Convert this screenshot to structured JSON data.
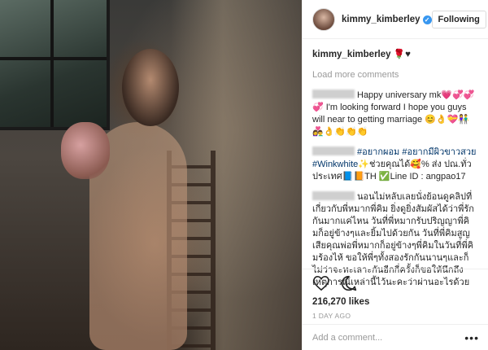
{
  "post": {
    "username": "kimmy_kimberley",
    "follow_label": "Following",
    "caption_emoji": "🌹♥",
    "load_more": "Load more comments",
    "comments": [
      {
        "text": "Happy universary mk💗💞💞💞 I'm looking forward I hope you guys will near to getting marriage 😊👌💝👫👩‍❤️‍👨👌👏👏👏"
      },
      {
        "tags": "#อยากผอม #อยากมีผิวขาวสวย #Winkwhite",
        "text": "✨ช่วยคุณได้🥰% ส่ง ปณ.ทั่วประเทศ📘📙TH ✅Line ID : angpao17"
      },
      {
        "text": "นอนไม่หลับเลยนั่งย้อนดูคลิปที่เกี่ยวกับพี่หมากพี่คิม ยิ่งดูยิ่งสัมผัสได้ว่าพี่รักกันมากแค่ไหน วันที่พี่หมากรับปริญญาพี่คิมก็อยู่ข้างๆและยิ้มไปด้วยกัน วันที่พี่คิมสูญเสียคุณพ่อพี่หมากก็อยู่ข้างๆพี่คิมในวันที่พี่คิมร้องไห้ ขอให้พี่ๆทั้งสองรักกันนานๆและก็ไม่ว่าจะทะเลาะกันอีกกี่ครั้งก็ขอให้นึกถึงเหตุการณ์เหล่านี้ไว้นะคะว่าผ่านอะไรด้วยกันมามากจริงๆ รักพี่ทั้งสองและก็ติดตามพี่ๆมาตั้งแต่ปี4 ปีแล้วเหมือนกัน ซักวันจะหาโอกาสไปเจอและถ่ายรูปให้ได้ค่ะ รักนะ"
      }
    ],
    "likes": "216,270 likes",
    "time": "1 DAY AGO",
    "add_comment_placeholder": "Add a comment...",
    "more_label": "•••"
  },
  "icons": {
    "like": "heart-icon",
    "comment": "comment-bubble-icon",
    "verified": "verified-badge-icon",
    "more": "ellipsis-icon"
  },
  "colors": {
    "link": "#003569",
    "verified": "#3897f0",
    "muted": "#999999",
    "border": "#efefef"
  }
}
